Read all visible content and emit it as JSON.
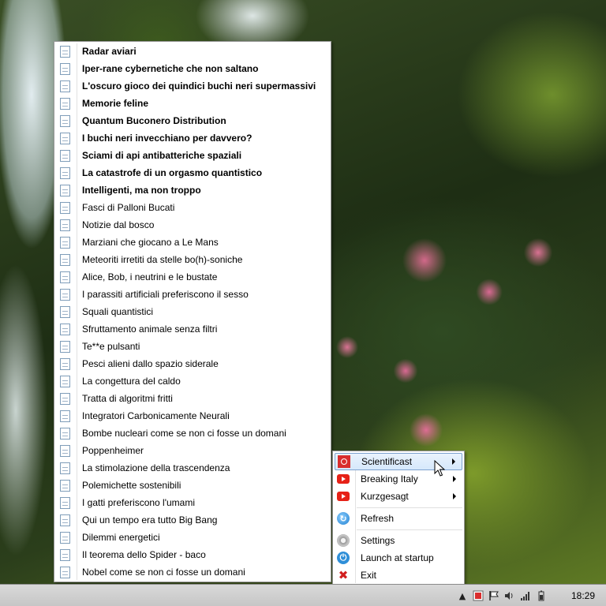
{
  "episodes": [
    {
      "label": "Radar aviari",
      "bold": true
    },
    {
      "label": "Iper-rane cybernetiche che non saltano",
      "bold": true
    },
    {
      "label": "L'oscuro gioco dei quindici buchi neri supermassivi",
      "bold": true
    },
    {
      "label": "Memorie feline",
      "bold": true
    },
    {
      "label": "Quantum Buconero Distribution",
      "bold": true
    },
    {
      "label": "I buchi neri invecchiano per davvero?",
      "bold": true
    },
    {
      "label": "Sciami di api antibatteriche spaziali",
      "bold": true
    },
    {
      "label": "La catastrofe di un orgasmo quantistico",
      "bold": true
    },
    {
      "label": "Intelligenti, ma non troppo",
      "bold": true
    },
    {
      "label": "Fasci di Palloni Bucati",
      "bold": false
    },
    {
      "label": "Notizie dal bosco",
      "bold": false
    },
    {
      "label": "Marziani che giocano a Le Mans",
      "bold": false
    },
    {
      "label": "Meteoriti irretiti da stelle bo(h)-soniche",
      "bold": false
    },
    {
      "label": "Alice, Bob, i neutrini e le bustate",
      "bold": false
    },
    {
      "label": "I parassiti artificiali preferiscono il sesso",
      "bold": false
    },
    {
      "label": "Squali quantistici",
      "bold": false
    },
    {
      "label": "Sfruttamento animale senza filtri",
      "bold": false
    },
    {
      "label": "Te**e pulsanti",
      "bold": false
    },
    {
      "label": "Pesci alieni dallo spazio siderale",
      "bold": false
    },
    {
      "label": "La congettura del caldo",
      "bold": false
    },
    {
      "label": "Tratta di algoritmi fritti",
      "bold": false
    },
    {
      "label": "Integratori Carbonicamente Neurali",
      "bold": false
    },
    {
      "label": "Bombe nucleari come se non ci fosse un domani",
      "bold": false
    },
    {
      "label": "Poppenheimer",
      "bold": false
    },
    {
      "label": "La stimolazione della trascendenza",
      "bold": false
    },
    {
      "label": "Polemichette sostenibili",
      "bold": false
    },
    {
      "label": "I gatti preferiscono l'umami",
      "bold": false
    },
    {
      "label": "Qui un tempo era tutto Big Bang",
      "bold": false
    },
    {
      "label": "Dilemmi energetici",
      "bold": false
    },
    {
      "label": "Il teorema dello Spider - baco",
      "bold": false
    },
    {
      "label": "Nobel come se non ci fosse un domani",
      "bold": false
    }
  ],
  "podcast_menu": {
    "podcasts": [
      {
        "label": "Scientificast",
        "icon": "scientificast-icon",
        "highlighted": true
      },
      {
        "label": "Breaking Italy",
        "icon": "youtube-icon",
        "highlighted": false
      },
      {
        "label": "Kurzgesagt",
        "icon": "youtube-icon",
        "highlighted": false
      }
    ],
    "refresh_label": "Refresh",
    "settings_label": "Settings",
    "startup_label": "Launch at startup",
    "exit_label": "Exit"
  },
  "taskbar": {
    "clock": "18:29"
  },
  "colors": {
    "highlight_border": "#7da2ce",
    "youtube_red": "#e62117",
    "exit_red": "#d11f1f"
  }
}
